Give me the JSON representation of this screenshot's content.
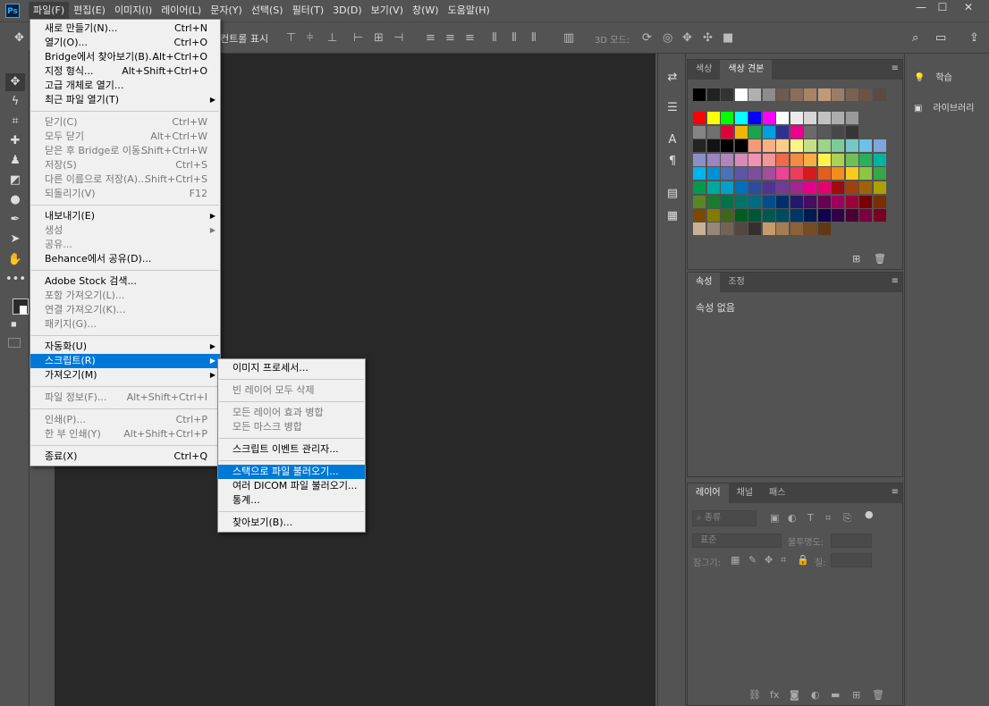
{
  "app_logo": "Ps",
  "menubar": [
    "파일(F)",
    "편집(E)",
    "이미지(I)",
    "레이어(L)",
    "문자(Y)",
    "선택(S)",
    "필터(T)",
    "3D(D)",
    "보기(V)",
    "창(W)",
    "도움말(H)"
  ],
  "options_bar": {
    "partial_label": "컨트롤 표시",
    "mode_label": "3D 모드:"
  },
  "file_menu": [
    {
      "label": "새로 만들기(N)...",
      "shortcut": "Ctrl+N",
      "disabled": false
    },
    {
      "label": "열기(O)...",
      "shortcut": "Ctrl+O",
      "disabled": false
    },
    {
      "label": "Bridge에서 찾아보기(B)...",
      "shortcut": "Alt+Ctrl+O",
      "disabled": false
    },
    {
      "label": "지정 형식...",
      "shortcut": "Alt+Shift+Ctrl+O",
      "disabled": false
    },
    {
      "label": "고급 개체로 열기...",
      "shortcut": "",
      "disabled": false
    },
    {
      "label": "최근 파일 열기(T)",
      "shortcut": "",
      "disabled": false,
      "submenu": true
    },
    {
      "sep": true
    },
    {
      "label": "닫기(C)",
      "shortcut": "Ctrl+W",
      "disabled": true
    },
    {
      "label": "모두 닫기",
      "shortcut": "Alt+Ctrl+W",
      "disabled": true
    },
    {
      "label": "닫은 후 Bridge로 이동...",
      "shortcut": "Shift+Ctrl+W",
      "disabled": true
    },
    {
      "label": "저장(S)",
      "shortcut": "Ctrl+S",
      "disabled": true
    },
    {
      "label": "다른 이름으로 저장(A)...",
      "shortcut": "Shift+Ctrl+S",
      "disabled": true
    },
    {
      "label": "되돌리기(V)",
      "shortcut": "F12",
      "disabled": true
    },
    {
      "sep": true
    },
    {
      "label": "내보내기(E)",
      "shortcut": "",
      "disabled": false,
      "submenu": true
    },
    {
      "label": "생성",
      "shortcut": "",
      "disabled": true,
      "submenu": true
    },
    {
      "label": "공유...",
      "shortcut": "",
      "disabled": true
    },
    {
      "label": "Behance에서 공유(D)...",
      "shortcut": "",
      "disabled": false
    },
    {
      "sep": true
    },
    {
      "label": "Adobe Stock 검색...",
      "shortcut": "",
      "disabled": false
    },
    {
      "label": "포함 가져오기(L)...",
      "shortcut": "",
      "disabled": true
    },
    {
      "label": "연결 가져오기(K)...",
      "shortcut": "",
      "disabled": true
    },
    {
      "label": "패키지(G)...",
      "shortcut": "",
      "disabled": true
    },
    {
      "sep": true
    },
    {
      "label": "자동화(U)",
      "shortcut": "",
      "disabled": false,
      "submenu": true
    },
    {
      "label": "스크립트(R)",
      "shortcut": "",
      "disabled": false,
      "submenu": true,
      "highlight": true
    },
    {
      "label": "가져오기(M)",
      "shortcut": "",
      "disabled": false,
      "submenu": true
    },
    {
      "sep": true
    },
    {
      "label": "파일 정보(F)...",
      "shortcut": "Alt+Shift+Ctrl+I",
      "disabled": true
    },
    {
      "sep": true
    },
    {
      "label": "인쇄(P)...",
      "shortcut": "Ctrl+P",
      "disabled": true
    },
    {
      "label": "한 부 인쇄(Y)",
      "shortcut": "Alt+Shift+Ctrl+P",
      "disabled": true
    },
    {
      "sep": true
    },
    {
      "label": "종료(X)",
      "shortcut": "Ctrl+Q",
      "disabled": false
    }
  ],
  "script_submenu": [
    {
      "label": "이미지 프로세서...",
      "disabled": false
    },
    {
      "sep": true
    },
    {
      "label": "빈 레이어 모두 삭제",
      "disabled": true
    },
    {
      "sep": true
    },
    {
      "label": "모든 레이어 효과 병합",
      "disabled": true
    },
    {
      "label": "모든 마스크 병합",
      "disabled": true
    },
    {
      "sep": true
    },
    {
      "label": "스크립트 이벤트 관리자...",
      "disabled": false
    },
    {
      "sep": true
    },
    {
      "label": "스택으로 파일 불러오기...",
      "disabled": false,
      "highlight": true
    },
    {
      "label": "여러 DICOM 파일 불러오기...",
      "disabled": false
    },
    {
      "label": "통계...",
      "disabled": false
    },
    {
      "sep": true
    },
    {
      "label": "찾아보기(B)...",
      "disabled": false
    }
  ],
  "swatches_panel": {
    "tabs": [
      "색상",
      "색상 견본"
    ],
    "active": 1
  },
  "properties_panel": {
    "tabs": [
      "속성",
      "조정"
    ],
    "empty_text": "속성 없음"
  },
  "layers_panel": {
    "tabs": [
      "레이어",
      "채널",
      "패스"
    ],
    "filter_placeholder": "종류",
    "blend_mode": "표준",
    "opacity_label": "불투명도:",
    "lock_label": "잠그기:",
    "fill_label": "칠:"
  },
  "right_dock": {
    "learn": "학습",
    "libraries": "라이브러리"
  },
  "colors": {
    "accent": "#0078d7",
    "swatch_rows": [
      [
        "#000000",
        "#222222",
        "#333333",
        "#ffffff",
        "#b0b0b0",
        "#8c8c8c",
        "#6e5a4e",
        "#8a6e5c",
        "#a68468",
        "#bf9a7a",
        "#9a7d66",
        "#7a6252",
        "#6a5446",
        "#5c4a3e"
      ],
      [
        "#ff0000",
        "#ffff00",
        "#00ff00",
        "#00ffff",
        "#0000ff",
        "#ff00ff",
        "#ffffff",
        "#ebebeb",
        "#d6d6d6",
        "#c2c2c2",
        "#adadad",
        "#999999"
      ],
      [
        "#858585",
        "#707070",
        "#e0003a",
        "#f3b600",
        "#1ea34a",
        "#00a0e0",
        "#2e3192",
        "#ec008c",
        "#6b6b6b",
        "#595959",
        "#474747",
        "#363636"
      ],
      [
        "#242424",
        "#121212",
        "#000000",
        "#000000",
        "#f39a7a",
        "#f7b183",
        "#fbcd8a",
        "#fff48a",
        "#c6e08a",
        "#9ed38a",
        "#7ccc99",
        "#74c9c5",
        "#6dc0e8",
        "#7fa6dc"
      ],
      [
        "#8a8fc8",
        "#9a85c0",
        "#b284bc",
        "#d88ab8",
        "#f392b3",
        "#f2969a",
        "#ed6a4a",
        "#f18c45",
        "#f9ad45",
        "#fff24b",
        "#acd154",
        "#70bf55",
        "#28b15b",
        "#00b3a1"
      ],
      [
        "#00b4ef",
        "#0091d5",
        "#4a72b7",
        "#5c56a6",
        "#7c4f9e",
        "#a34e9c",
        "#eb4495",
        "#ee3c5c",
        "#d71920",
        "#e55d1e",
        "#f48d1d",
        "#fcca1d",
        "#8dc63f",
        "#38a548"
      ],
      [
        "#009a4e",
        "#00a99d",
        "#00a0c6",
        "#0071b9",
        "#2e4c9e",
        "#4e3591",
        "#743a91",
        "#a0278f",
        "#e5008a",
        "#e5006d",
        "#9e0b0f",
        "#a0410d",
        "#a1620a",
        "#abA000"
      ],
      [
        "#598527",
        "#197b30",
        "#00734a",
        "#007567",
        "#006b83",
        "#004f8a",
        "#002f6c",
        "#25176b",
        "#440e62",
        "#660051",
        "#9e005d",
        "#9e0039",
        "#7a0000",
        "#7b2e00"
      ],
      [
        "#7d4900",
        "#827b00",
        "#406618",
        "#005e20",
        "#005737",
        "#00584f",
        "#004c5e",
        "#003663",
        "#001b4f",
        "#10034d",
        "#310048",
        "#4a0034",
        "#780042",
        "#7a0026"
      ],
      [
        "#c7b299",
        "#998675",
        "#736357",
        "#534741",
        "#37302a",
        "#c69c6d",
        "#a67c52",
        "#8c6239",
        "#754c24",
        "#603913"
      ]
    ]
  }
}
